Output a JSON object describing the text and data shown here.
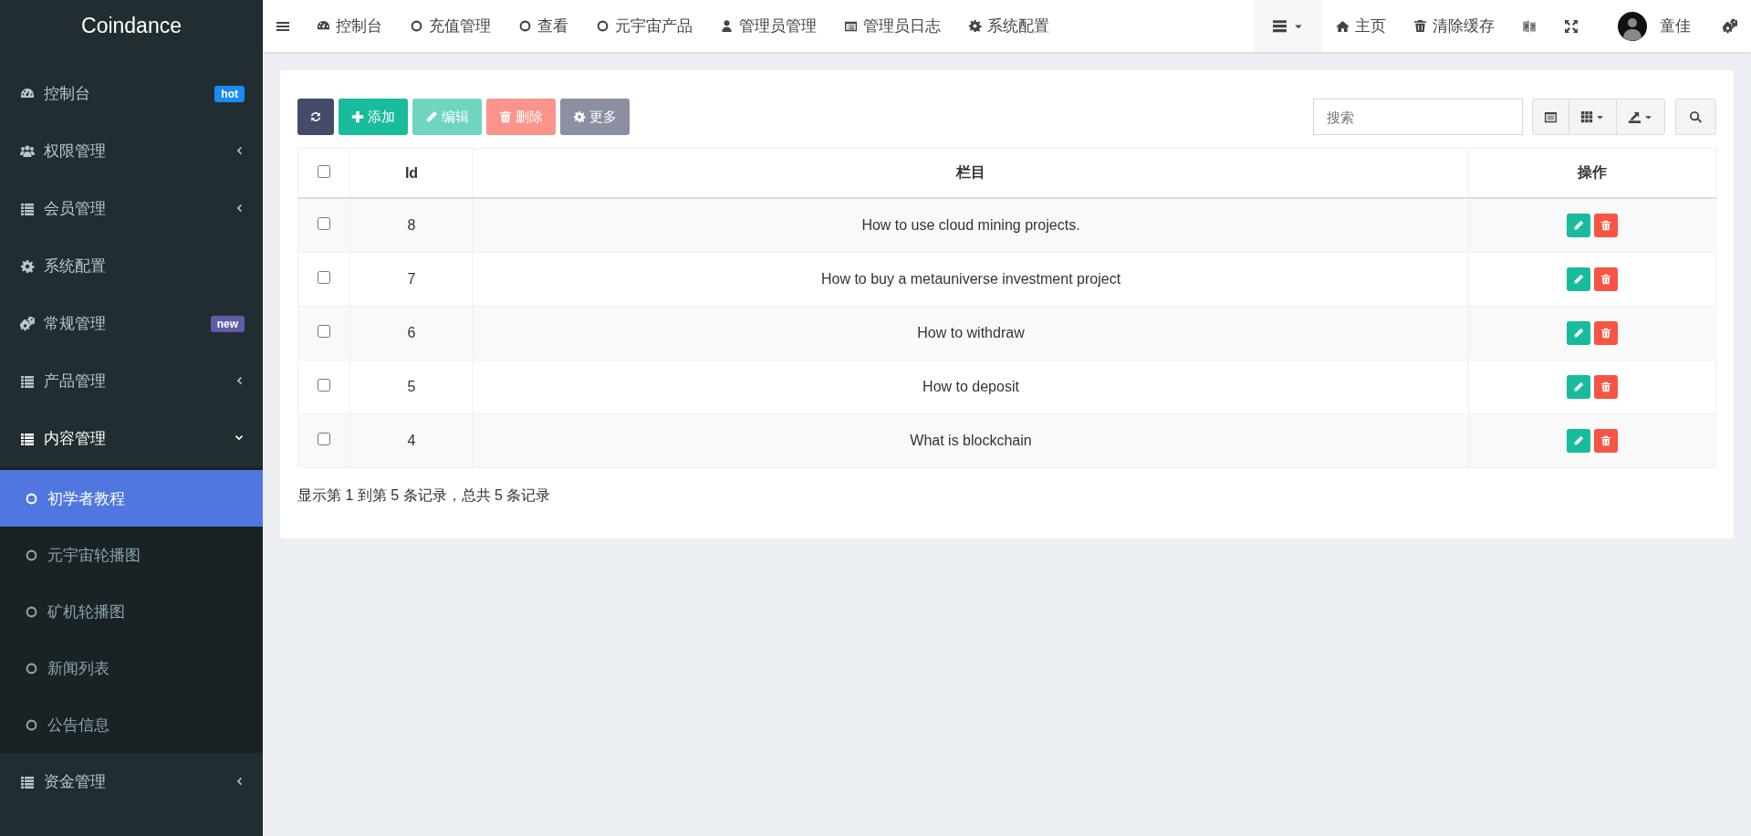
{
  "brand": "Coindance",
  "topnav": [
    {
      "label": "控制台"
    },
    {
      "label": "充值管理"
    },
    {
      "label": "查看"
    },
    {
      "label": "元宇宙产品"
    },
    {
      "label": "管理员管理"
    },
    {
      "label": "管理员日志"
    },
    {
      "label": "系统配置"
    }
  ],
  "topnav_right": [
    {
      "kind": "dropdown"
    },
    {
      "kind": "link",
      "label": "主页"
    },
    {
      "kind": "link",
      "label": "清除缓存"
    },
    {
      "kind": "icon"
    },
    {
      "kind": "icon"
    },
    {
      "kind": "user",
      "label": "童佳"
    },
    {
      "kind": "icon"
    }
  ],
  "sidebar": {
    "items": [
      {
        "label": "控制台",
        "badge": {
          "text": "hot",
          "color": "#1a8cf0"
        }
      },
      {
        "label": "权限管理",
        "expanded": false
      },
      {
        "label": "会员管理",
        "expanded": false
      },
      {
        "label": "系统配置"
      },
      {
        "label": "常规管理",
        "badge": {
          "text": "new",
          "color": "#605ca8"
        }
      },
      {
        "label": "产品管理",
        "expanded": false
      },
      {
        "label": "内容管理",
        "expanded": true,
        "children": [
          {
            "label": "初学者教程",
            "selected": true
          },
          {
            "label": "元宇宙轮播图",
            "selected": false
          },
          {
            "label": "矿机轮播图",
            "selected": false
          },
          {
            "label": "新闻列表",
            "selected": false
          },
          {
            "label": "公告信息",
            "selected": false
          }
        ]
      },
      {
        "label": "资金管理",
        "expanded": false
      }
    ]
  },
  "toolbar": {
    "buttons": [
      {
        "kind": "refresh",
        "disabled": false
      },
      {
        "kind": "add",
        "label": "添加",
        "disabled": false
      },
      {
        "kind": "edit",
        "label": "编辑",
        "disabled": true
      },
      {
        "kind": "delete",
        "label": "删除",
        "disabled": true
      },
      {
        "kind": "more",
        "label": "更多",
        "disabled": true
      }
    ],
    "search": {
      "placeholder": "搜索"
    }
  },
  "table": {
    "columns": [
      "Id",
      "栏目",
      "操作"
    ],
    "select_all_checked": false,
    "rows": [
      {
        "id": "8",
        "title": "How to use cloud mining projects.",
        "checked": false
      },
      {
        "id": "7",
        "title": "How to buy a metauniverse investment project",
        "checked": false
      },
      {
        "id": "6",
        "title": "How to withdraw",
        "checked": false
      },
      {
        "id": "5",
        "title": "How to deposit",
        "checked": false
      },
      {
        "id": "4",
        "title": "What is blockchain",
        "checked": false
      }
    ]
  },
  "pagination_info": "显示第 1 到第 5 条记录，总共 5 条记录"
}
